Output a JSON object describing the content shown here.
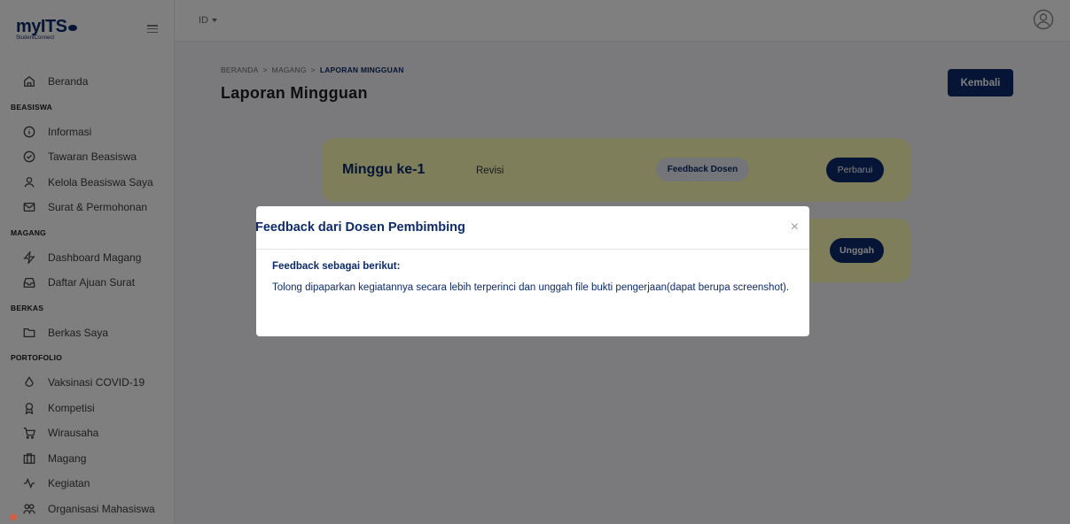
{
  "sidebar": {
    "brand": "myITS",
    "brand_sub": "StudentConnect",
    "items": [
      {
        "type": "item",
        "label": "Beranda",
        "icon": "home-icon"
      },
      {
        "type": "section",
        "label": "BEASISWA"
      },
      {
        "type": "item",
        "label": "Informasi",
        "icon": "info-icon"
      },
      {
        "type": "item",
        "label": "Tawaran Beasiswa",
        "icon": "check-circle-icon"
      },
      {
        "type": "item",
        "label": "Kelola Beasiswa Saya",
        "icon": "user-icon"
      },
      {
        "type": "item",
        "label": "Surat & Permohonan",
        "icon": "mail-icon"
      },
      {
        "type": "section",
        "label": "MAGANG"
      },
      {
        "type": "item",
        "label": "Dashboard Magang",
        "icon": "lightning-icon"
      },
      {
        "type": "item",
        "label": "Daftar Ajuan Surat",
        "icon": "inbox-icon"
      },
      {
        "type": "section",
        "label": "BERKAS"
      },
      {
        "type": "item",
        "label": "Berkas Saya",
        "icon": "folder-icon"
      },
      {
        "type": "section",
        "label": "PORTOFOLIO"
      },
      {
        "type": "item",
        "label": "Vaksinasi COVID-19",
        "icon": "droplet-icon"
      },
      {
        "type": "item",
        "label": "Kompetisi",
        "icon": "award-icon"
      },
      {
        "type": "item",
        "label": "Wirausaha",
        "icon": "cart-icon"
      },
      {
        "type": "item",
        "label": "Magang",
        "icon": "building-icon"
      },
      {
        "type": "item",
        "label": "Kegiatan",
        "icon": "activity-icon"
      },
      {
        "type": "item",
        "label": "Organisasi Mahasiswa",
        "icon": "org-icon"
      }
    ]
  },
  "topbar": {
    "lang": "ID"
  },
  "breadcrumb": {
    "l1": "BERANDA",
    "l2": "MAGANG",
    "current": "LAPORAN MINGGUAN",
    "sep": ">"
  },
  "page": {
    "title": "Laporan Mingguan",
    "back_label": "Kembali"
  },
  "weeks": [
    {
      "title": "Minggu ke-1",
      "status": "Revisi",
      "feedback_label": "Feedback Dosen",
      "action_label": "Perbarui"
    },
    {
      "action_label": "Unggah"
    }
  ],
  "modal": {
    "title": "Feedback dari Dosen Pembimbing",
    "close": "×",
    "heading": "Feedback sebagai berikut:",
    "text": "Tolong dipaparkan kegiatannya secara lebih terperinci dan unggah file bukti pengerjaan(dapat berupa screenshot)."
  },
  "colors": {
    "primary": "#0d2a6b",
    "card_bg": "#fefcb4",
    "overlay": "rgba(0,0,0,0.5)"
  }
}
